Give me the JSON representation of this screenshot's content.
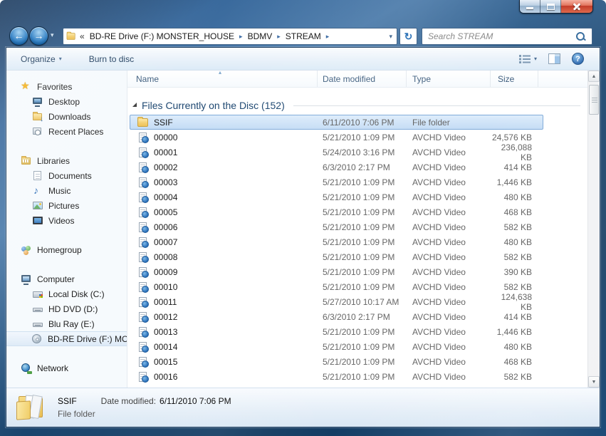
{
  "nav": {
    "breadcrumb_prefix": "«",
    "breadcrumb": [
      "BD-RE Drive (F:) MONSTER_HOUSE",
      "BDMV",
      "STREAM"
    ],
    "search_placeholder": "Search STREAM"
  },
  "icons": {
    "back": "←",
    "forward": "→",
    "history_chevron": "▾",
    "breadcrumb_arrow": "▸",
    "address_dropdown": "▾",
    "refresh": "↻",
    "dropdown_chevron": "▾",
    "help": "?",
    "sort_ascending": "▴",
    "download_arrow": "↓",
    "scroll_up": "▲",
    "scroll_down": "▼"
  },
  "toolbar": {
    "organize": "Organize",
    "burn_to_disc": "Burn to disc"
  },
  "columns": {
    "name": "Name",
    "date_modified": "Date modified",
    "type": "Type",
    "size": "Size"
  },
  "group_header": {
    "label": "Files Currently on the Disc (152)"
  },
  "files": [
    {
      "name": "SSIF",
      "date": "6/11/2010 7:06 PM",
      "type": "File folder",
      "size": ""
    },
    {
      "name": "00000",
      "date": "5/21/2010 1:09 PM",
      "type": "AVCHD Video",
      "size": "24,576 KB"
    },
    {
      "name": "00001",
      "date": "5/24/2010 3:16 PM",
      "type": "AVCHD Video",
      "size": "236,088 KB"
    },
    {
      "name": "00002",
      "date": "6/3/2010 2:17 PM",
      "type": "AVCHD Video",
      "size": "414 KB"
    },
    {
      "name": "00003",
      "date": "5/21/2010 1:09 PM",
      "type": "AVCHD Video",
      "size": "1,446 KB"
    },
    {
      "name": "00004",
      "date": "5/21/2010 1:09 PM",
      "type": "AVCHD Video",
      "size": "480 KB"
    },
    {
      "name": "00005",
      "date": "5/21/2010 1:09 PM",
      "type": "AVCHD Video",
      "size": "468 KB"
    },
    {
      "name": "00006",
      "date": "5/21/2010 1:09 PM",
      "type": "AVCHD Video",
      "size": "582 KB"
    },
    {
      "name": "00007",
      "date": "5/21/2010 1:09 PM",
      "type": "AVCHD Video",
      "size": "480 KB"
    },
    {
      "name": "00008",
      "date": "5/21/2010 1:09 PM",
      "type": "AVCHD Video",
      "size": "582 KB"
    },
    {
      "name": "00009",
      "date": "5/21/2010 1:09 PM",
      "type": "AVCHD Video",
      "size": "390 KB"
    },
    {
      "name": "00010",
      "date": "5/21/2010 1:09 PM",
      "type": "AVCHD Video",
      "size": "582 KB"
    },
    {
      "name": "00011",
      "date": "5/27/2010 10:17 AM",
      "type": "AVCHD Video",
      "size": "124,638 KB"
    },
    {
      "name": "00012",
      "date": "6/3/2010 2:17 PM",
      "type": "AVCHD Video",
      "size": "414 KB"
    },
    {
      "name": "00013",
      "date": "5/21/2010 1:09 PM",
      "type": "AVCHD Video",
      "size": "1,446 KB"
    },
    {
      "name": "00014",
      "date": "5/21/2010 1:09 PM",
      "type": "AVCHD Video",
      "size": "480 KB"
    },
    {
      "name": "00015",
      "date": "5/21/2010 1:09 PM",
      "type": "AVCHD Video",
      "size": "468 KB"
    },
    {
      "name": "00016",
      "date": "5/21/2010 1:09 PM",
      "type": "AVCHD Video",
      "size": "582 KB"
    }
  ],
  "sidebar": {
    "favorites": {
      "label": "Favorites",
      "items": [
        {
          "label": "Desktop"
        },
        {
          "label": "Downloads"
        },
        {
          "label": "Recent Places"
        }
      ]
    },
    "libraries": {
      "label": "Libraries",
      "items": [
        {
          "label": "Documents"
        },
        {
          "label": "Music"
        },
        {
          "label": "Pictures"
        },
        {
          "label": "Videos"
        }
      ]
    },
    "homegroup": {
      "label": "Homegroup"
    },
    "computer": {
      "label": "Computer",
      "items": [
        {
          "label": "Local Disk (C:)"
        },
        {
          "label": "HD DVD (D:)"
        },
        {
          "label": "Blu Ray (E:)"
        },
        {
          "label": "BD-RE Drive (F:) MO"
        }
      ]
    },
    "network": {
      "label": "Network"
    }
  },
  "details_pane": {
    "name": "SSIF",
    "date_label": "Date modified:",
    "date_value": "6/11/2010 7:06 PM",
    "type": "File folder"
  },
  "colors": {
    "aero_blue": "#2d5f93",
    "close_red": "#c23b28",
    "selection_fill": "#d6e9fb",
    "selection_border": "#7da9d8",
    "group_header_text": "#1c4670",
    "header_text": "#3f5e7e",
    "secondary_text": "#666666"
  }
}
